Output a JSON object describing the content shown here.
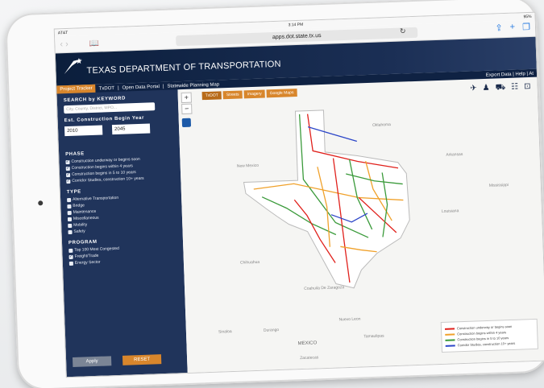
{
  "device": {
    "carrier": "AT&T",
    "time": "3:14 PM",
    "battery": "95%"
  },
  "browser": {
    "url": "apps.dot.state.tx.us"
  },
  "header": {
    "agency": "TEXAS DEPARTMENT OF TRANSPORTATION"
  },
  "nav": {
    "active": "Project Tracker",
    "links": [
      "TxDOT",
      "Open Data Portal",
      "Statewide Planning Map"
    ],
    "right": "Export Data | Help | At"
  },
  "sidebar": {
    "search_title": "SEARCH by KEYWORD",
    "search_placeholder": "City, County, District, MPO...",
    "year_title": "Est. Construction Begin Year",
    "year_from": "2010",
    "year_to": "2045",
    "phase_title": "PHASE",
    "phases": [
      "Construction underway or begins soon",
      "Construction begins within 4 years",
      "Construction begins in 5 to 10 years",
      "Corridor Studies, construction 10+ years"
    ],
    "type_title": "TYPE",
    "types": [
      "Alternative Transportation",
      "Bridge",
      "Maintenance",
      "Miscellaneous",
      "Mobility",
      "Safety"
    ],
    "program_title": "PROGRAM",
    "programs": [
      "Top 100 Most Congested",
      "Freight/Trade",
      "Energy Sector"
    ],
    "apply": "Apply",
    "reset": "RESET"
  },
  "map": {
    "basemaps": [
      "TxDOT",
      "Streets",
      "Imagery",
      "Google Maps"
    ],
    "labels": {
      "oklahoma": "Oklahoma",
      "arkansas": "Arkansas",
      "newmexico": "New Mexico",
      "louisiana": "Louisiana",
      "mississippi": "Mississippi",
      "chihuahua": "Chihuahua",
      "coahuila": "Coahuila De Zaragoza",
      "sinaloa": "Sinaloa",
      "durango": "Durango",
      "nuevoleon": "Nuevo Leon",
      "tamaulipas": "Tamaulipas",
      "mexico": "MEXICO",
      "zacatecas": "Zacatecas"
    },
    "legend": [
      {
        "label": "Construction underway or begins soon",
        "color": "#e0201b"
      },
      {
        "label": "Construction begins within 4 years",
        "color": "#f0a12a"
      },
      {
        "label": "Construction begins in 5 to 10 years",
        "color": "#3a9a3a"
      },
      {
        "label": "Corridor Studies, construction 10+ years",
        "color": "#2b45c8"
      }
    ],
    "mode_icons": [
      "airplane-icon",
      "pedestrian-icon",
      "bus-icon",
      "rail-icon",
      "transit-icon"
    ]
  }
}
